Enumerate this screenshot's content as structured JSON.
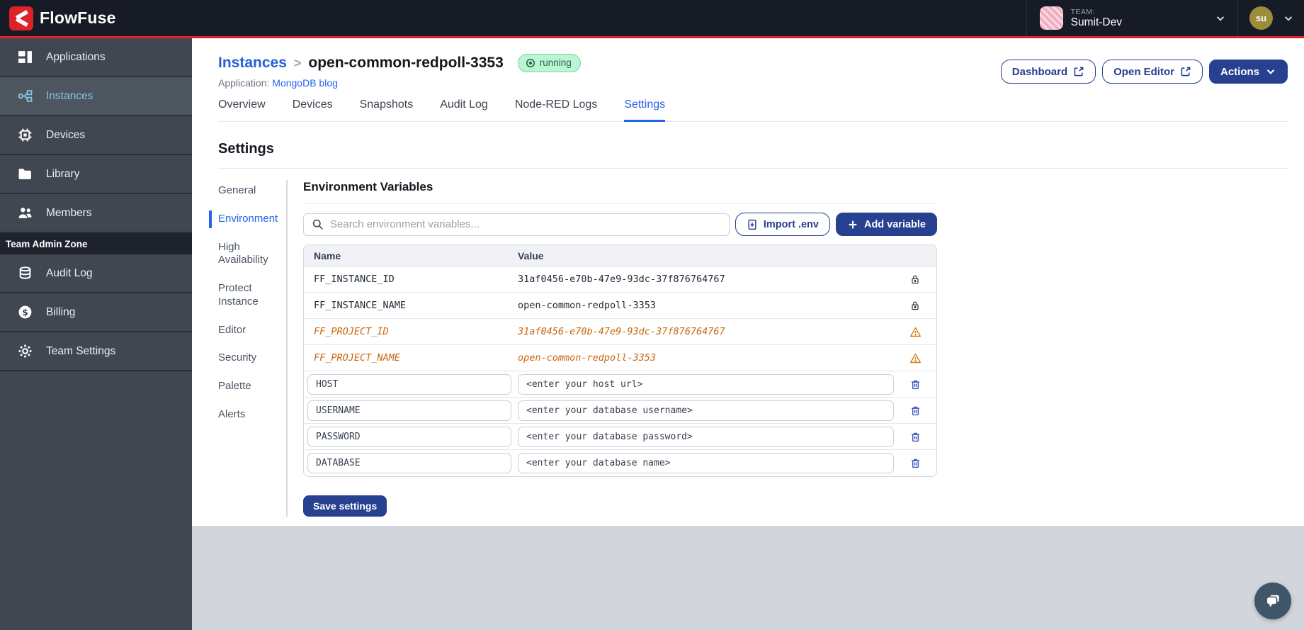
{
  "brand": {
    "name": "FlowFuse"
  },
  "topbar": {
    "team_label": "TEAM:",
    "team_name": "Sumit-Dev",
    "user_initials": "su"
  },
  "sidebar": {
    "items": [
      {
        "label": "Applications"
      },
      {
        "label": "Instances"
      },
      {
        "label": "Devices"
      },
      {
        "label": "Library"
      },
      {
        "label": "Members"
      }
    ],
    "admin_zone_label": "Team Admin Zone",
    "admin_items": [
      {
        "label": "Audit Log"
      },
      {
        "label": "Billing"
      },
      {
        "label": "Team Settings"
      }
    ]
  },
  "page": {
    "breadcrumb_root": "Instances",
    "breadcrumb_sep": ">",
    "instance_name": "open-common-redpoll-3353",
    "status": "running",
    "application_label": "Application:",
    "application_name": "MongoDB blog",
    "dashboard_label": "Dashboard",
    "open_editor_label": "Open Editor",
    "actions_label": "Actions"
  },
  "tabs": [
    "Overview",
    "Devices",
    "Snapshots",
    "Audit Log",
    "Node-RED Logs",
    "Settings"
  ],
  "settings": {
    "title": "Settings",
    "nav": [
      "General",
      "Environment",
      "High Availability",
      "Protect Instance",
      "Editor",
      "Security",
      "Palette",
      "Alerts"
    ],
    "active": "Environment"
  },
  "env": {
    "title": "Environment Variables",
    "search_placeholder": "Search environment variables...",
    "import_label": "Import .env",
    "add_label": "Add variable",
    "col_name": "Name",
    "col_value": "Value",
    "rows": [
      {
        "name": "FF_INSTANCE_ID",
        "value": "31af0456-e70b-47e9-93dc-37f876764767",
        "state": "locked"
      },
      {
        "name": "FF_INSTANCE_NAME",
        "value": "open-common-redpoll-3353",
        "state": "locked"
      },
      {
        "name": "FF_PROJECT_ID",
        "value": "31af0456-e70b-47e9-93dc-37f876764767",
        "state": "deprecated"
      },
      {
        "name": "FF_PROJECT_NAME",
        "value": "open-common-redpoll-3353",
        "state": "deprecated"
      }
    ],
    "editable_rows": [
      {
        "name": "HOST",
        "value": "<enter your host url>"
      },
      {
        "name": "USERNAME",
        "value": "<enter your database username>"
      },
      {
        "name": "PASSWORD",
        "value": "<enter your database password>"
      },
      {
        "name": "DATABASE",
        "value": "<enter your database name>"
      }
    ],
    "save_label": "Save settings"
  },
  "colors": {
    "accent_red": "#dd2329",
    "navy": "#27408f",
    "link_blue": "#2563eb",
    "sidebar_active_text": "#86c6df",
    "running_badge_bg": "#bdf4d2",
    "running_badge_text": "#20684c",
    "deprecated_orange": "#c9660f"
  }
}
